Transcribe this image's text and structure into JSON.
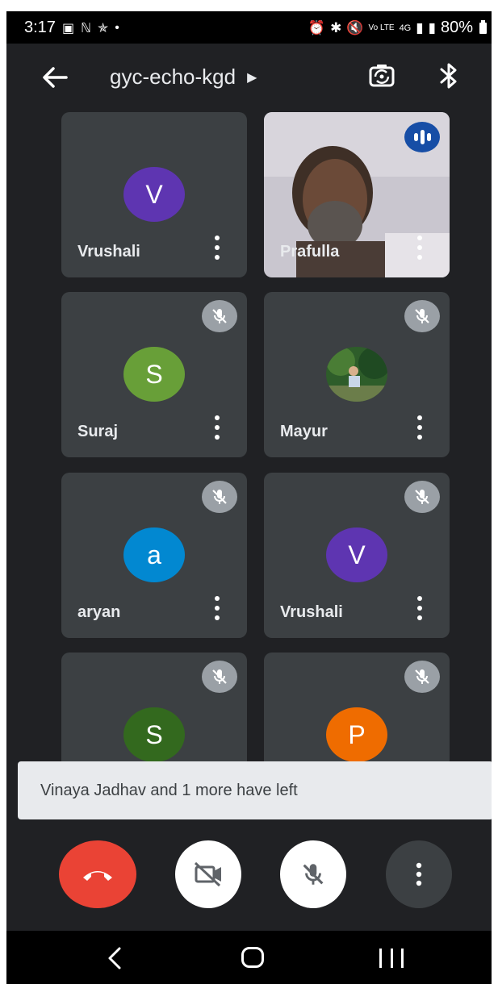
{
  "status_bar": {
    "time": "3:17",
    "left_icons": [
      "gallery-icon",
      "n-icon",
      "fitness-icon",
      "dot-icon"
    ],
    "right_icons": [
      "alarm-icon",
      "bluetooth-icon",
      "mute-icon",
      "volte-icon",
      "4g-icon",
      "signal-icon",
      "signal-icon"
    ],
    "battery": "80%"
  },
  "header": {
    "meeting_code": "gyc-echo-kgd"
  },
  "participants": [
    {
      "name": "Vrushali",
      "initial": "V",
      "avatar_color": "#5e35b1",
      "muted": false,
      "speaking": false,
      "video": false
    },
    {
      "name": "Prafulla",
      "initial": "",
      "avatar_color": "",
      "muted": false,
      "speaking": true,
      "video": true
    },
    {
      "name": "Suraj",
      "initial": "S",
      "avatar_color": "#689f38",
      "muted": true,
      "speaking": false,
      "video": false
    },
    {
      "name": "Mayur",
      "initial": "",
      "avatar_color": "",
      "muted": true,
      "speaking": false,
      "video": false,
      "photo": true
    },
    {
      "name": "aryan",
      "initial": "a",
      "avatar_color": "#0288d1",
      "muted": true,
      "speaking": false,
      "video": false
    },
    {
      "name": "Vrushali",
      "initial": "V",
      "avatar_color": "#5e35b1",
      "muted": true,
      "speaking": false,
      "video": false
    },
    {
      "name": "",
      "initial": "S",
      "avatar_color": "#33691e",
      "muted": true,
      "speaking": false,
      "video": false
    },
    {
      "name": "",
      "initial": "P",
      "avatar_color": "#ef6c00",
      "muted": true,
      "speaking": false,
      "video": false
    }
  ],
  "toast": {
    "message": "Vinaya Jadhav and 1 more have left"
  },
  "controls": {
    "end_call": "end-call-icon",
    "camera": "camera-off-icon",
    "mic": "mic-off-icon",
    "more": "more-vert-icon"
  },
  "colors": {
    "background": "#202124",
    "tile": "#3c4043",
    "end_call": "#ea4335",
    "speaking": "#174ea6"
  }
}
